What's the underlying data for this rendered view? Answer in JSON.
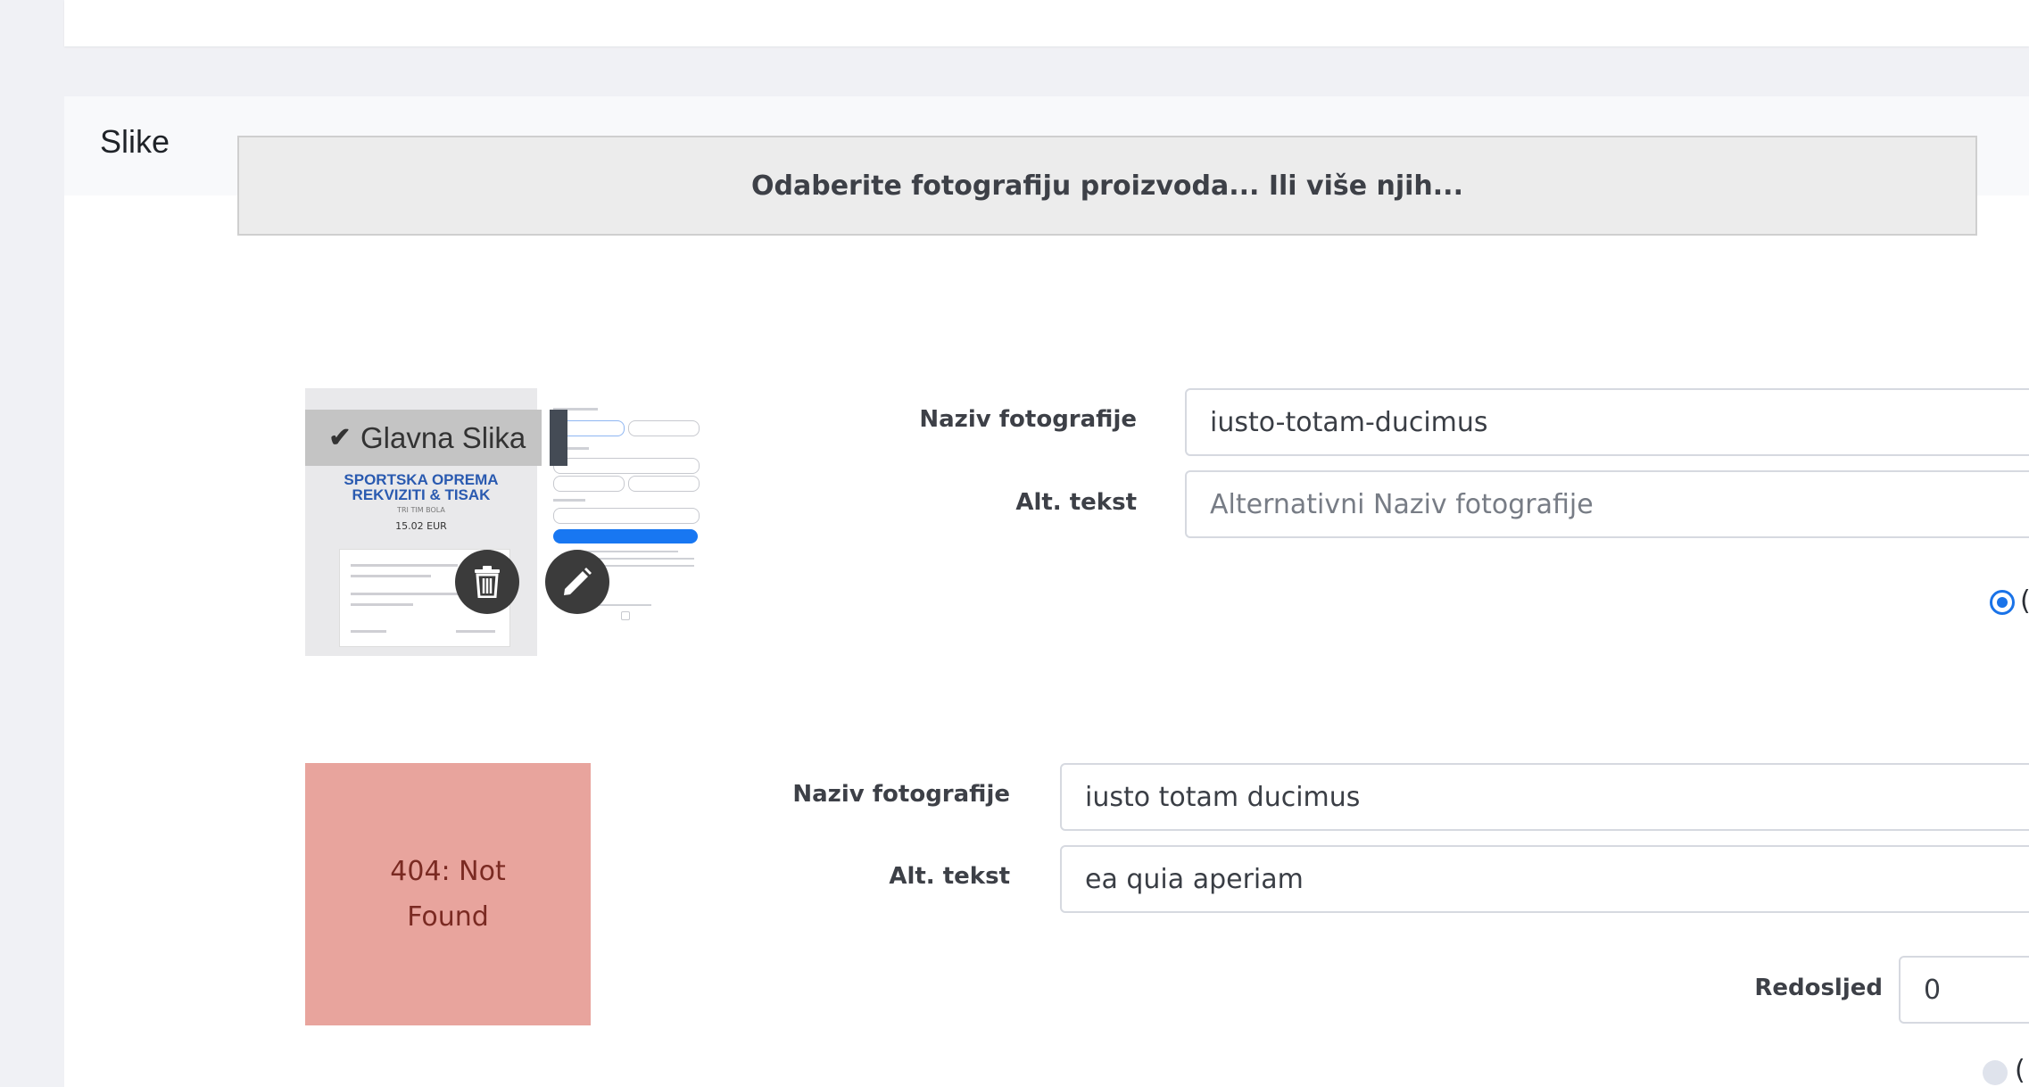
{
  "section": {
    "title": "Slike"
  },
  "upload": {
    "label": "Odaberite fotografiju proizvoda... Ili više njih..."
  },
  "images": [
    {
      "badge": {
        "label": "Glavna Slika",
        "icon": "check-icon"
      },
      "thumbnail": {
        "heading_line1": "SPORTSKA OPREMA",
        "heading_line2": "REKVIZITI & TISAK",
        "subtitle": "TRI TIM BOLA",
        "price": "15.02 EUR"
      },
      "actions": {
        "delete_icon": "trash-icon",
        "edit_icon": "pencil-icon"
      },
      "name_label": "Naziv fotografije",
      "name_value": "iusto-totam-ducimus",
      "alt_label": "Alt. tekst",
      "alt_value": "",
      "alt_placeholder": "Alternativni Naziv fotografije",
      "radio_selected": true,
      "radio_tail": "("
    },
    {
      "broken_image_text": "404: Not Found",
      "name_label": "Naziv fotografije",
      "name_value": "iusto totam ducimus",
      "alt_label": "Alt. tekst",
      "alt_value": "ea quia aperiam",
      "order_label": "Redosljed",
      "order_value": "0",
      "radio_selected": false,
      "radio_tail": "("
    }
  ],
  "colors": {
    "page_bg": "#f0f1f5",
    "upload_bg": "#ececec",
    "badge_bg": "#c4c4c4",
    "broken_bg": "#e8a49d",
    "accent": "#1a73e8"
  }
}
